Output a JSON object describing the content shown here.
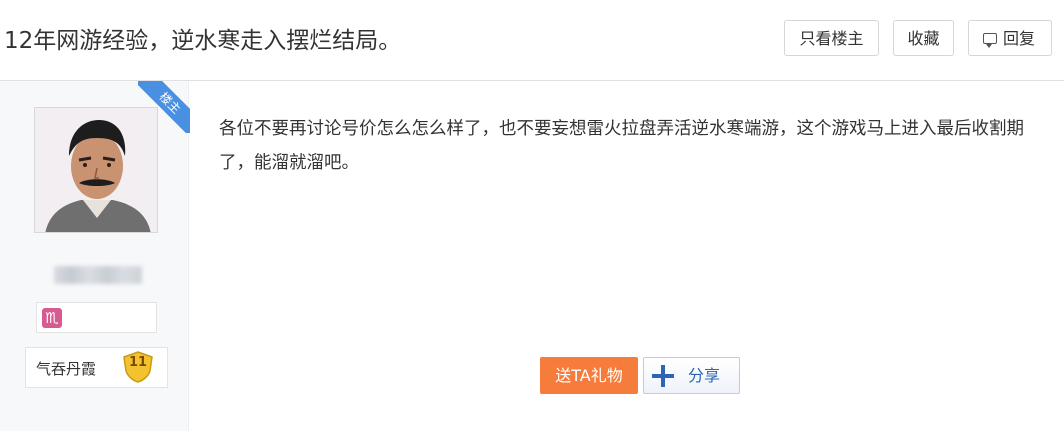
{
  "thread": {
    "title": "12年网游经验，逆水寒走入摆烂结局。"
  },
  "toolbar": {
    "only_op_label": "只看楼主",
    "collect_label": "收藏",
    "reply_label": "回复"
  },
  "author": {
    "ribbon_label": "楼主",
    "zodiac_symbol": "♏",
    "level_title": "气吞丹霞",
    "level_number": "11"
  },
  "post": {
    "content": "各位不要再讨论号价怎么怎么样了，也不要妄想雷火拉盘弄活逆水寒端游，这个游戏马上进入最后收割期了，能溜就溜吧。"
  },
  "actions": {
    "gift_label": "送TA礼物",
    "share_label": "分享"
  },
  "colors": {
    "gift": "#f57c3a",
    "share_text": "#2d64b3",
    "ribbon": "#4a90e2",
    "zodiac": "#d85a93",
    "level_badge": "#f2c230"
  }
}
